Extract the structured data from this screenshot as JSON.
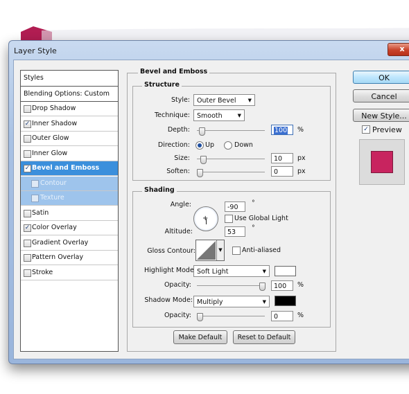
{
  "window": {
    "title": "Layer Style",
    "close_glyph": "x"
  },
  "styles_list": {
    "header": "Styles",
    "blending": "Blending Options: Custom",
    "items": [
      {
        "label": "Drop Shadow",
        "checked": ""
      },
      {
        "label": "Inner Shadow",
        "checked": "✓"
      },
      {
        "label": "Outer Glow",
        "checked": ""
      },
      {
        "label": "Inner Glow",
        "checked": ""
      },
      {
        "label": "Bevel and Emboss",
        "checked": "✓"
      },
      {
        "label": "Contour",
        "checked": ""
      },
      {
        "label": "Texture",
        "checked": ""
      },
      {
        "label": "Satin",
        "checked": ""
      },
      {
        "label": "Color Overlay",
        "checked": "✓"
      },
      {
        "label": "Gradient Overlay",
        "checked": ""
      },
      {
        "label": "Pattern Overlay",
        "checked": ""
      },
      {
        "label": "Stroke",
        "checked": ""
      }
    ],
    "selected": "Bevel and Emboss"
  },
  "bevel": {
    "group_title": "Bevel and Emboss",
    "structure": {
      "title": "Structure",
      "style_label": "Style:",
      "style_value": "Outer Bevel",
      "technique_label": "Technique:",
      "technique_value": "Smooth",
      "depth_label": "Depth:",
      "depth_value": "100",
      "depth_unit": "%",
      "depth_level": 0.03,
      "direction_label": "Direction:",
      "direction_up": "Up",
      "direction_down": "Down",
      "direction_selected": "Up",
      "size_label": "Size:",
      "size_value": "10",
      "size_unit": "px",
      "size_level": 0.05,
      "soften_label": "Soften:",
      "soften_value": "0",
      "soften_unit": "px",
      "soften_level": 0.0
    },
    "shading": {
      "title": "Shading",
      "angle_label": "Angle:",
      "angle_value": "-90",
      "angle_unit": "°",
      "global_light_label": "Use Global Light",
      "global_light_checked": "",
      "altitude_label": "Altitude:",
      "altitude_value": "53",
      "altitude_unit": "°",
      "gloss_label": "Gloss Contour:",
      "antialias_label": "Anti-aliased",
      "antialias_checked": "",
      "highlight_label": "Highlight Mode:",
      "highlight_value": "Soft Light",
      "highlight_color": "#ffffff",
      "h_opacity_label": "Opacity:",
      "h_opacity_value": "100",
      "h_opacity_unit": "%",
      "h_opacity_level": 1.0,
      "shadow_label": "Shadow Mode:",
      "shadow_value": "Multiply",
      "shadow_color": "#000000",
      "s_opacity_label": "Opacity:",
      "s_opacity_value": "0",
      "s_opacity_unit": "%",
      "s_opacity_level": 0.0
    },
    "make_default": "Make Default",
    "reset_default": "Reset to Default"
  },
  "buttons": {
    "ok": "OK",
    "cancel": "Cancel",
    "new_style": "New Style...",
    "preview": "Preview",
    "preview_checked": "✓"
  },
  "colors": {
    "preview_fill": "#c8245f",
    "accent": "#3b8fdc"
  }
}
